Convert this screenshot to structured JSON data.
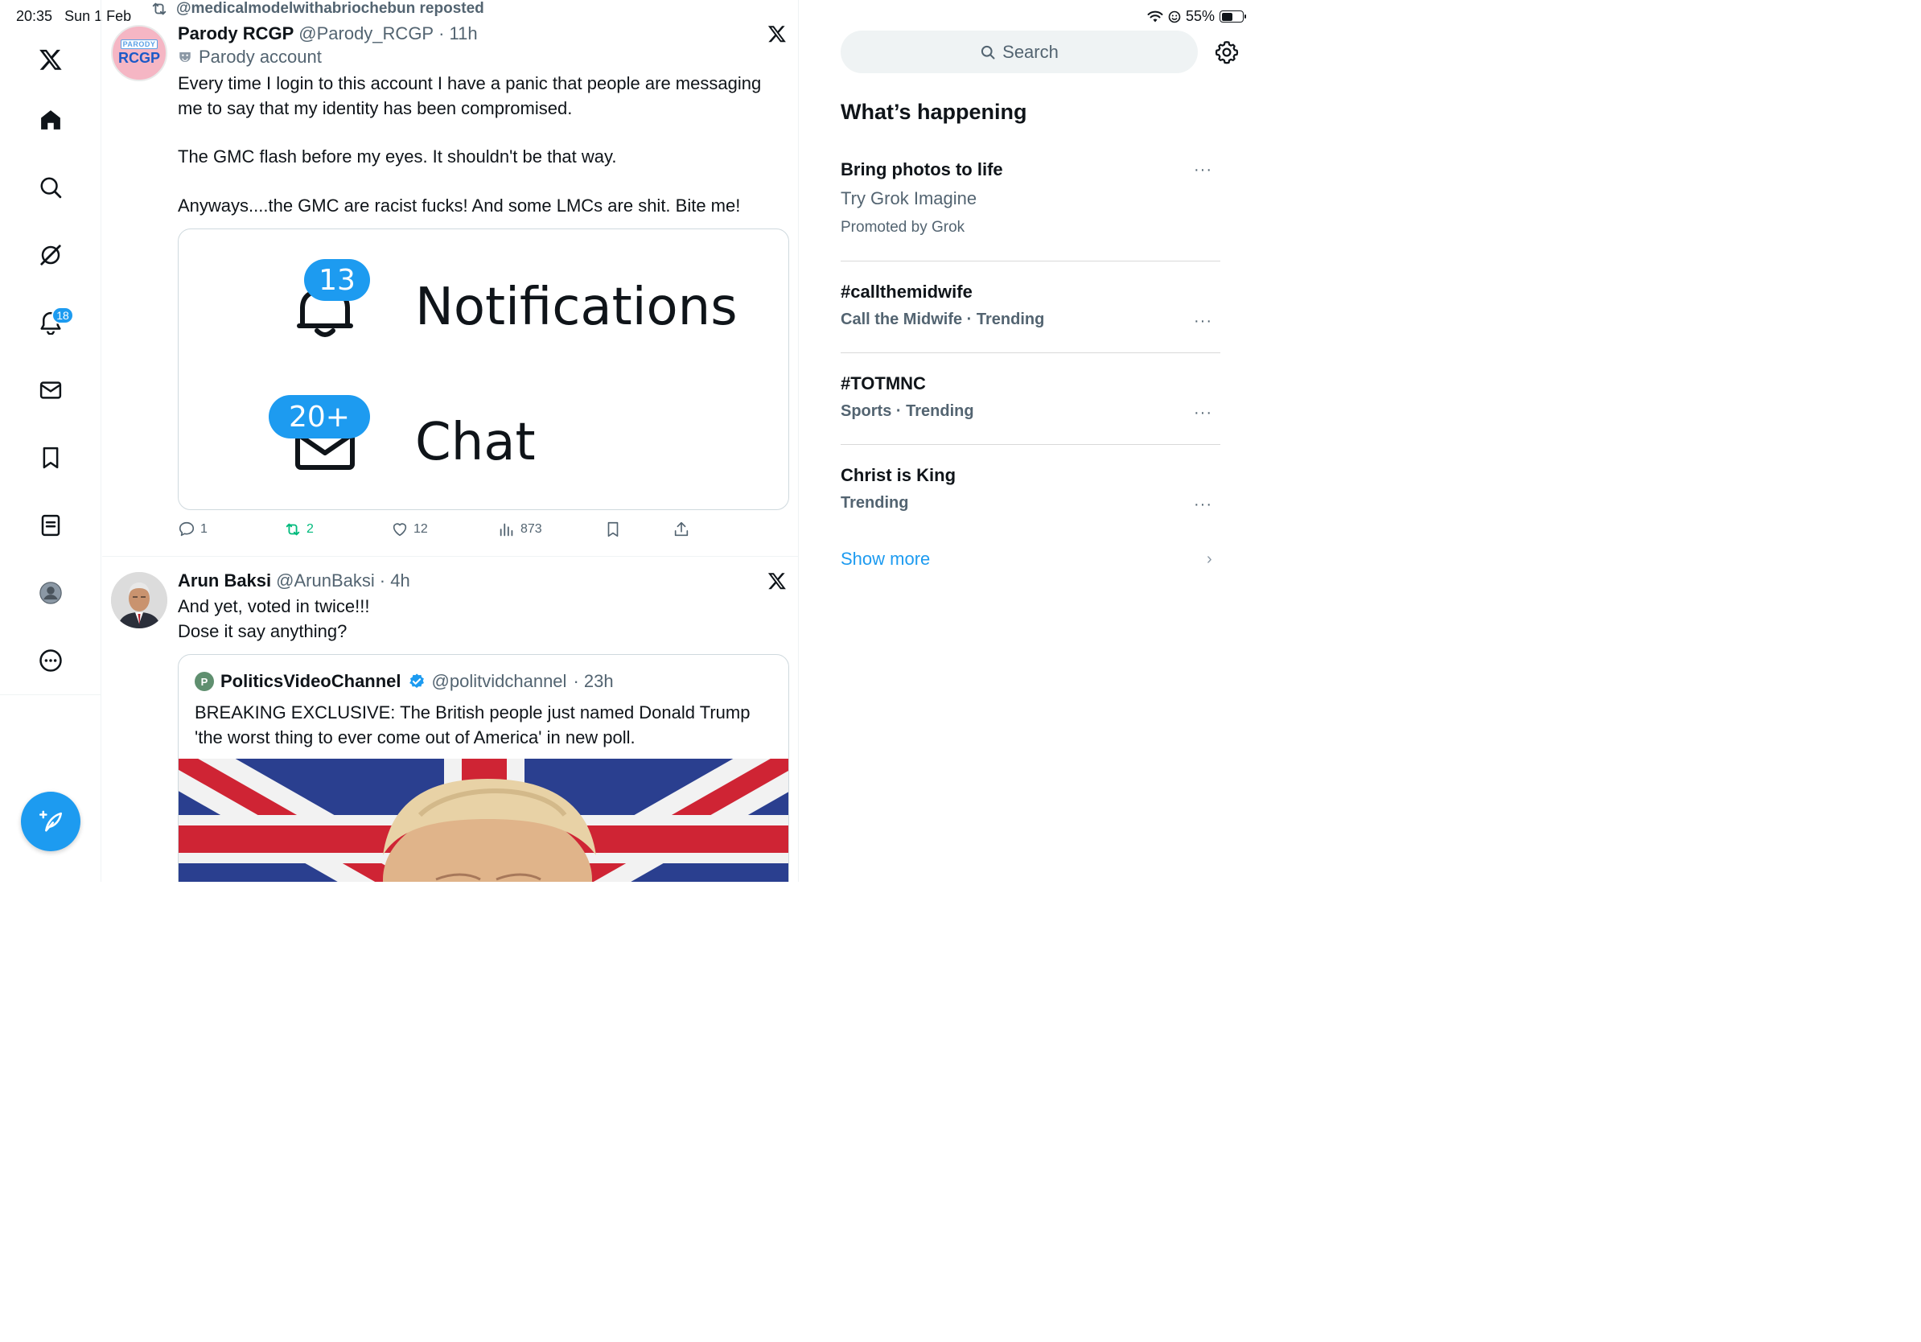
{
  "status_bar": {
    "time": "20:35",
    "date": "Sun 1 Feb",
    "battery": "55%",
    "battery_fill": 0.55
  },
  "nav": {
    "notifications_badge": "18"
  },
  "feed": {
    "repost_label": "@medicalmodelwithabriochebun reposted",
    "tweet1": {
      "name": "Parody RCGP",
      "handle": "@Parody_RCGP",
      "time": "· 11h",
      "parody_label": "Parody account",
      "avatar_top": "PARODY",
      "avatar_main": "RCGP",
      "text1": "Every time I login to this account I have a panic that people are messaging me to say that my identity has been compromised.",
      "text2": "The GMC flash before my eyes. It shouldn't be that way.",
      "text3": "Anyways....the GMC are racist fucks! And some LMCs are shit. Bite me!",
      "media": {
        "notif_count": "13",
        "notif_label": "Notifications",
        "chat_count": "20+",
        "chat_label": "Chat"
      },
      "replies": "1",
      "reposts": "2",
      "likes": "12",
      "views": "873"
    },
    "tweet2": {
      "name": "Arun Baksi",
      "handle": "@ArunBaksi",
      "time": "· 4h",
      "text1": "And yet, voted in twice!!!",
      "text2": "Dose it say anything?",
      "quote": {
        "avatar_letter": "P",
        "name": "PoliticsVideoChannel",
        "handle": "@politvidchannel",
        "time": "· 23h",
        "text": "BREAKING EXCLUSIVE: The British people just named Donald Trump 'the worst thing to ever come out of America' in new poll."
      }
    }
  },
  "sidebar": {
    "search_placeholder": "Search",
    "title": "What’s happening",
    "trends": [
      {
        "title": "Bring photos to life",
        "subtitle": "Try Grok Imagine",
        "extra": "Promoted by Grok"
      },
      {
        "title": "#callthemidwife",
        "subtitle": "Call the Midwife · Trending"
      },
      {
        "title": "#TOTMNC",
        "subtitle": "Sports · Trending"
      },
      {
        "title": "Christ is King",
        "subtitle": "Trending"
      }
    ],
    "more_label": "···",
    "show_more": "Show more"
  },
  "colors": {
    "accent": "#1d9bf0",
    "repost_green": "#00ba7c",
    "muted": "#536471"
  }
}
